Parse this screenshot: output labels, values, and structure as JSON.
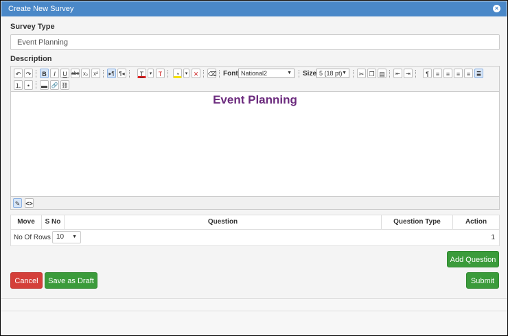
{
  "window": {
    "title": "Create New Survey"
  },
  "survey_type": {
    "label": "Survey Type",
    "value": "Event Planning"
  },
  "description": {
    "label": "Description",
    "toolbar": {
      "font_label": "Font",
      "font_value": "National2",
      "size_label": "Size",
      "size_value": "5 (18 pt)",
      "text_color": "#e01b1b",
      "highlight_color": "#f5e000"
    },
    "content_heading": "Event Planning",
    "content_color": "#6b2a7d"
  },
  "questions_table": {
    "columns": [
      "Move",
      "S No",
      "Question",
      "Question Type",
      "Action"
    ],
    "no_of_rows_label": "No Of Rows :",
    "no_of_rows_value": "10",
    "page_number": "1"
  },
  "buttons": {
    "add_question": "Add Question",
    "cancel": "Cancel",
    "save_draft": "Save as Draft",
    "submit": "Submit"
  },
  "colors": {
    "titlebar": "#4a88c8",
    "green": "#3b9b3b",
    "red": "#d43f3a"
  }
}
